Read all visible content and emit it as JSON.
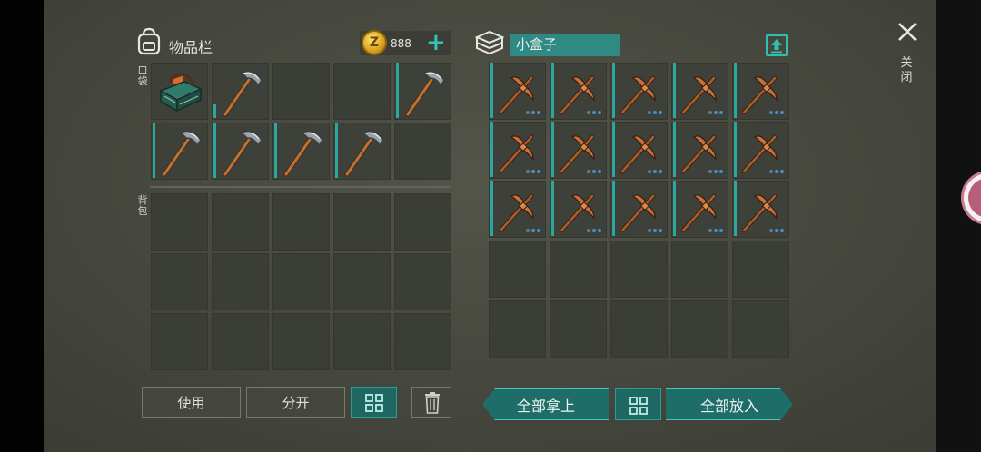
{
  "inventory": {
    "title": "物品栏",
    "coins": "888",
    "pocket_label": "口袋",
    "backpack_label": "背包",
    "pocket_slots": [
      {
        "item": "toolbox",
        "bar": 0
      },
      {
        "item": "stone-pickaxe",
        "bar": 0.25
      },
      {
        "item": null
      },
      {
        "item": null
      },
      {
        "item": "stone-pickaxe",
        "bar": 1
      },
      {
        "item": "stone-pickaxe",
        "bar": 1
      },
      {
        "item": "stone-pickaxe",
        "bar": 1
      },
      {
        "item": "stone-pickaxe",
        "bar": 1
      },
      {
        "item": "stone-pickaxe",
        "bar": 1
      },
      {
        "item": null
      }
    ],
    "backpack_rows": 3
  },
  "container": {
    "name": "小盒子",
    "filled_rows": 3,
    "columns": 5,
    "item": "copper-pickaxe",
    "empty_rows": 2
  },
  "buttons": {
    "use": "使用",
    "split": "分开",
    "take_all": "全部拿上",
    "put_all": "全部放入"
  },
  "close_label": "关闭",
  "icons": {
    "backpack": "backpack-icon",
    "coin": "coin-icon",
    "add": "plus-icon",
    "container": "box-stack-icon",
    "upload": "upload-icon",
    "sort": "grid-sort-icon",
    "trash": "trash-icon",
    "close": "close-icon"
  },
  "colors": {
    "accent": "#31c0af",
    "panel_bg": "#45473f",
    "slot_bg": "#3e403a"
  }
}
